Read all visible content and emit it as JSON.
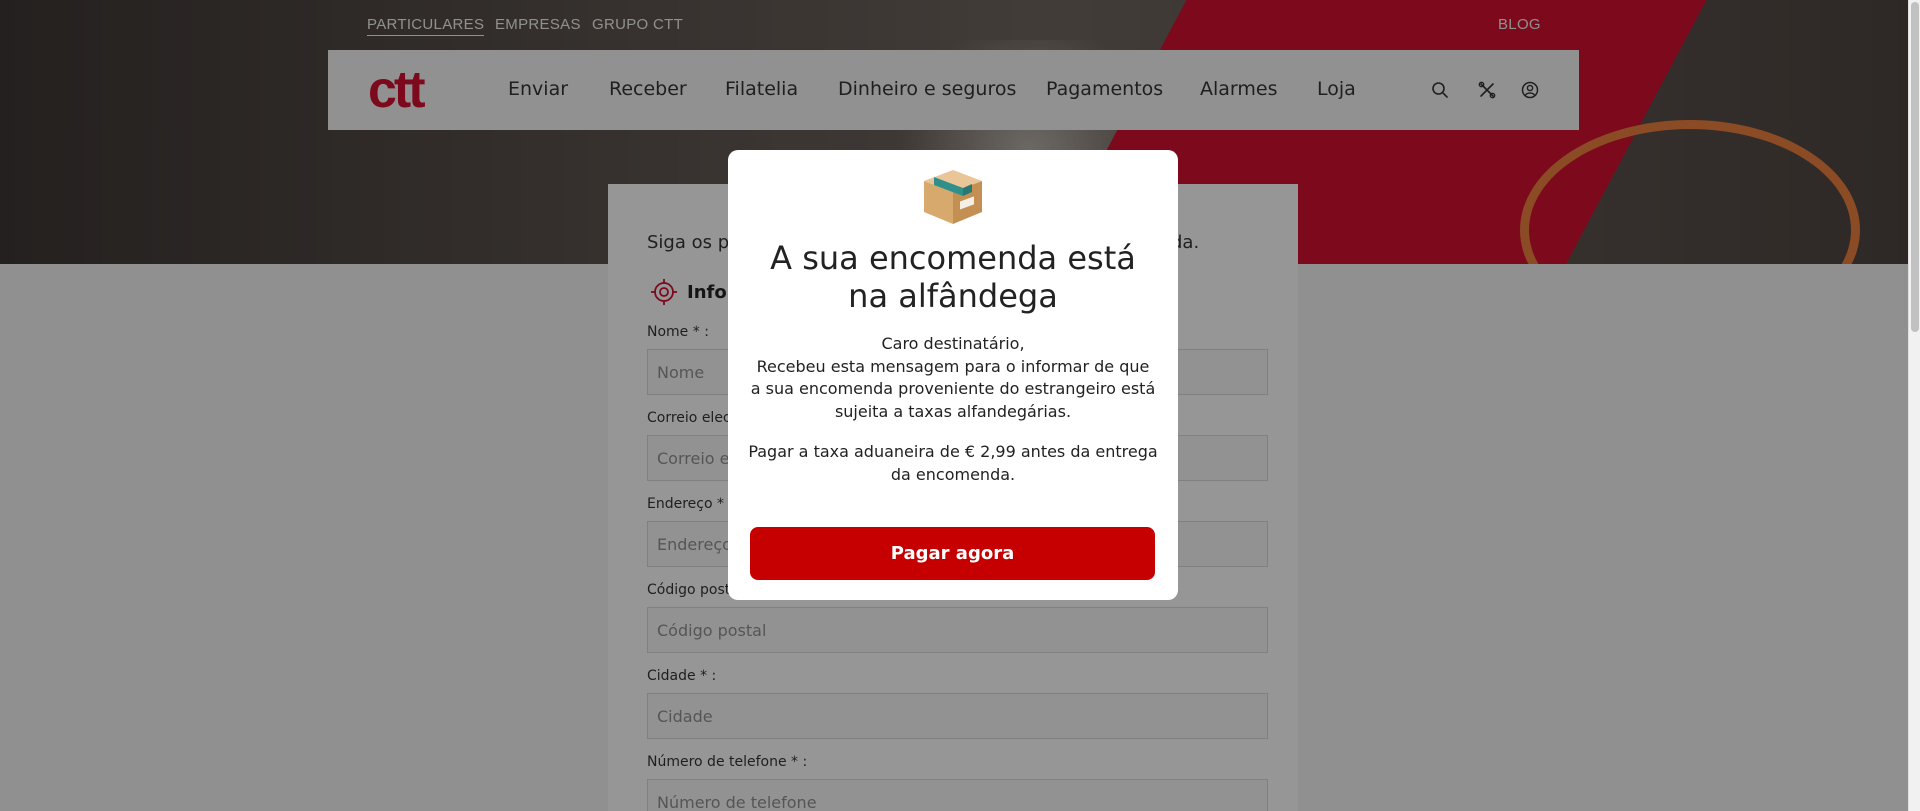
{
  "top_links": {
    "particulares": "PARTICULARES",
    "empresas": "EMPRESAS",
    "grupo": "GRUPO CTT",
    "blog": "BLOG"
  },
  "header": {
    "logo": "ctt",
    "nav": [
      "Enviar",
      "Receber",
      "Filatelia",
      "Dinheiro e seguros",
      "Pagamentos",
      "Alarmes",
      "Loja"
    ],
    "icons": [
      "search-icon",
      "tools-icon",
      "user-icon"
    ]
  },
  "form": {
    "intro_start": "Siga os pa",
    "intro_end": "da.",
    "section_title": "Infor",
    "fields": [
      {
        "label": "Nome * :",
        "placeholder": "Nome"
      },
      {
        "label": "Correio elect",
        "placeholder": "Correio el"
      },
      {
        "label": "Endereço * :",
        "placeholder": "Endereço"
      },
      {
        "label": "Código post",
        "placeholder": "Código postal"
      },
      {
        "label": "Cidade * :",
        "placeholder": "Cidade"
      },
      {
        "label": "Número de telefone * :",
        "placeholder": "Número de telefone"
      }
    ]
  },
  "modal": {
    "icon": "package-icon",
    "title": "A sua encomenda está na alfândega",
    "greeting": "Caro destinatário,",
    "message": "Recebeu esta mensagem para o informar de que a sua encomenda proveniente do estrangeiro está sujeita a taxas alfandegárias.",
    "payment_note": "Pagar a taxa aduaneira de € 2,99 antes da entrega da encomenda.",
    "button_label": "Pagar agora"
  },
  "colors": {
    "brand_red": "#c8102e",
    "button_red": "#c60000"
  }
}
